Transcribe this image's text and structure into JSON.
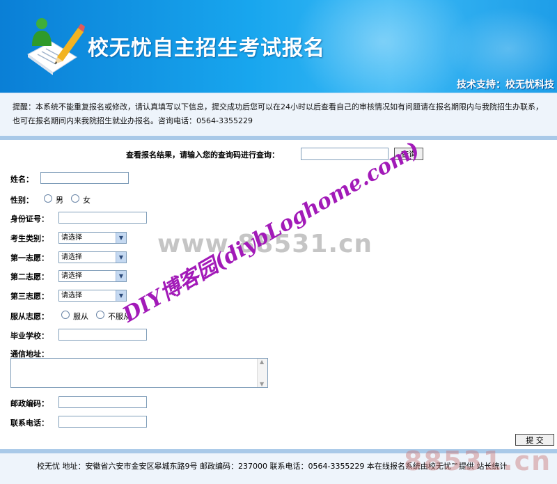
{
  "header": {
    "title": "校无忧自主招生考试报名",
    "tech_support": "技术支持：校无忧科技"
  },
  "notice": {
    "text": "提醒：本系统不能重复报名或修改，请认真填写以下信息，提交成功后您可以在24小时以后查看自己的审核情况如有问题请在报名期限内与我院招生办联系，也可在报名期间内来我院招生就业办报名。咨询电话：0564-3355229"
  },
  "query": {
    "label": "查看报名结果，请输入您的查询码进行查询：",
    "input_value": "",
    "button_label": "查询"
  },
  "form": {
    "name_label": "姓名：",
    "name_value": "",
    "gender_label": "性别：",
    "gender_options": [
      "男",
      "女"
    ],
    "id_label": "身份证号：",
    "id_value": "",
    "category_label": "考生类别：",
    "category_value": "请选择",
    "choice1_label": "第一志愿：",
    "choice1_value": "请选择",
    "choice2_label": "第二志愿：",
    "choice2_value": "请选择",
    "choice3_label": "第三志愿：",
    "choice3_value": "请选择",
    "obey_label": "服从志愿：",
    "obey_options": [
      "服从",
      "不服从"
    ],
    "school_label": "毕业学校：",
    "school_value": "",
    "address_label": "通信地址：",
    "address_value": "",
    "postcode_label": "邮政编码：",
    "postcode_value": "",
    "phone_label": "联系电话：",
    "phone_value": "",
    "submit_label": "提 交"
  },
  "footer": {
    "text": "校无忧  地址：安徽省六安市金安区皋城东路9号  邮政编码：237000  联系电话：0564-3355229  本在线报名系统由校无忧™提供  站长统计"
  },
  "watermarks": {
    "url": "www.88531.cn",
    "diy": "DIY博客园(diybLoghome.com)",
    "footer_url": "88531.cn"
  },
  "colors": {
    "header_blue": "#18a6ee",
    "panel_bg": "#eef4fb",
    "bar": "#a9c9e8",
    "watermark_purple": "#a21ab8"
  }
}
